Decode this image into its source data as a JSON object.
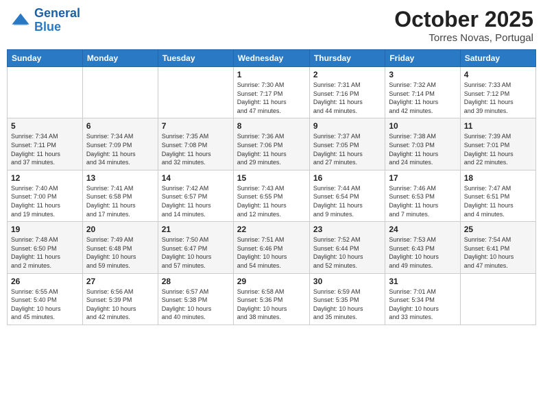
{
  "header": {
    "logo_line1": "General",
    "logo_line2": "Blue",
    "month": "October 2025",
    "location": "Torres Novas, Portugal"
  },
  "weekdays": [
    "Sunday",
    "Monday",
    "Tuesday",
    "Wednesday",
    "Thursday",
    "Friday",
    "Saturday"
  ],
  "weeks": [
    [
      {
        "day": "",
        "info": ""
      },
      {
        "day": "",
        "info": ""
      },
      {
        "day": "",
        "info": ""
      },
      {
        "day": "1",
        "info": "Sunrise: 7:30 AM\nSunset: 7:17 PM\nDaylight: 11 hours\nand 47 minutes."
      },
      {
        "day": "2",
        "info": "Sunrise: 7:31 AM\nSunset: 7:16 PM\nDaylight: 11 hours\nand 44 minutes."
      },
      {
        "day": "3",
        "info": "Sunrise: 7:32 AM\nSunset: 7:14 PM\nDaylight: 11 hours\nand 42 minutes."
      },
      {
        "day": "4",
        "info": "Sunrise: 7:33 AM\nSunset: 7:12 PM\nDaylight: 11 hours\nand 39 minutes."
      }
    ],
    [
      {
        "day": "5",
        "info": "Sunrise: 7:34 AM\nSunset: 7:11 PM\nDaylight: 11 hours\nand 37 minutes."
      },
      {
        "day": "6",
        "info": "Sunrise: 7:34 AM\nSunset: 7:09 PM\nDaylight: 11 hours\nand 34 minutes."
      },
      {
        "day": "7",
        "info": "Sunrise: 7:35 AM\nSunset: 7:08 PM\nDaylight: 11 hours\nand 32 minutes."
      },
      {
        "day": "8",
        "info": "Sunrise: 7:36 AM\nSunset: 7:06 PM\nDaylight: 11 hours\nand 29 minutes."
      },
      {
        "day": "9",
        "info": "Sunrise: 7:37 AM\nSunset: 7:05 PM\nDaylight: 11 hours\nand 27 minutes."
      },
      {
        "day": "10",
        "info": "Sunrise: 7:38 AM\nSunset: 7:03 PM\nDaylight: 11 hours\nand 24 minutes."
      },
      {
        "day": "11",
        "info": "Sunrise: 7:39 AM\nSunset: 7:01 PM\nDaylight: 11 hours\nand 22 minutes."
      }
    ],
    [
      {
        "day": "12",
        "info": "Sunrise: 7:40 AM\nSunset: 7:00 PM\nDaylight: 11 hours\nand 19 minutes."
      },
      {
        "day": "13",
        "info": "Sunrise: 7:41 AM\nSunset: 6:58 PM\nDaylight: 11 hours\nand 17 minutes."
      },
      {
        "day": "14",
        "info": "Sunrise: 7:42 AM\nSunset: 6:57 PM\nDaylight: 11 hours\nand 14 minutes."
      },
      {
        "day": "15",
        "info": "Sunrise: 7:43 AM\nSunset: 6:55 PM\nDaylight: 11 hours\nand 12 minutes."
      },
      {
        "day": "16",
        "info": "Sunrise: 7:44 AM\nSunset: 6:54 PM\nDaylight: 11 hours\nand 9 minutes."
      },
      {
        "day": "17",
        "info": "Sunrise: 7:46 AM\nSunset: 6:53 PM\nDaylight: 11 hours\nand 7 minutes."
      },
      {
        "day": "18",
        "info": "Sunrise: 7:47 AM\nSunset: 6:51 PM\nDaylight: 11 hours\nand 4 minutes."
      }
    ],
    [
      {
        "day": "19",
        "info": "Sunrise: 7:48 AM\nSunset: 6:50 PM\nDaylight: 11 hours\nand 2 minutes."
      },
      {
        "day": "20",
        "info": "Sunrise: 7:49 AM\nSunset: 6:48 PM\nDaylight: 10 hours\nand 59 minutes."
      },
      {
        "day": "21",
        "info": "Sunrise: 7:50 AM\nSunset: 6:47 PM\nDaylight: 10 hours\nand 57 minutes."
      },
      {
        "day": "22",
        "info": "Sunrise: 7:51 AM\nSunset: 6:46 PM\nDaylight: 10 hours\nand 54 minutes."
      },
      {
        "day": "23",
        "info": "Sunrise: 7:52 AM\nSunset: 6:44 PM\nDaylight: 10 hours\nand 52 minutes."
      },
      {
        "day": "24",
        "info": "Sunrise: 7:53 AM\nSunset: 6:43 PM\nDaylight: 10 hours\nand 49 minutes."
      },
      {
        "day": "25",
        "info": "Sunrise: 7:54 AM\nSunset: 6:41 PM\nDaylight: 10 hours\nand 47 minutes."
      }
    ],
    [
      {
        "day": "26",
        "info": "Sunrise: 6:55 AM\nSunset: 5:40 PM\nDaylight: 10 hours\nand 45 minutes."
      },
      {
        "day": "27",
        "info": "Sunrise: 6:56 AM\nSunset: 5:39 PM\nDaylight: 10 hours\nand 42 minutes."
      },
      {
        "day": "28",
        "info": "Sunrise: 6:57 AM\nSunset: 5:38 PM\nDaylight: 10 hours\nand 40 minutes."
      },
      {
        "day": "29",
        "info": "Sunrise: 6:58 AM\nSunset: 5:36 PM\nDaylight: 10 hours\nand 38 minutes."
      },
      {
        "day": "30",
        "info": "Sunrise: 6:59 AM\nSunset: 5:35 PM\nDaylight: 10 hours\nand 35 minutes."
      },
      {
        "day": "31",
        "info": "Sunrise: 7:01 AM\nSunset: 5:34 PM\nDaylight: 10 hours\nand 33 minutes."
      },
      {
        "day": "",
        "info": ""
      }
    ]
  ]
}
